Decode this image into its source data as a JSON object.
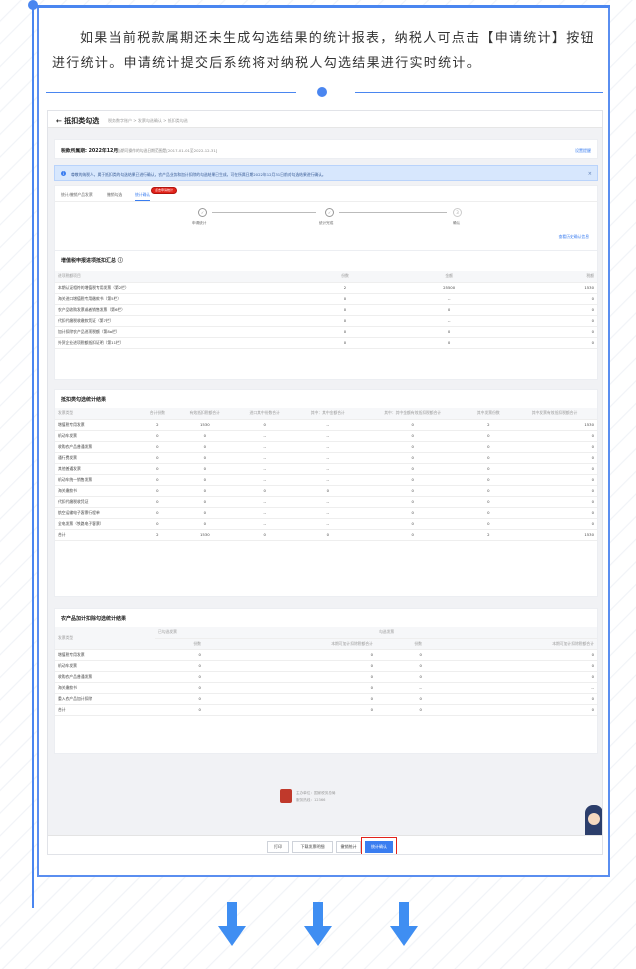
{
  "intro_text": "如果当前税款属期还未生成勾选结果的统计报表，纳税人可点击【申请统计】按钮进行统计。申请统计提交后系统将对纳税人勾选结果进行实时统计。",
  "app": {
    "back_label": "← 抵扣类勾选",
    "breadcrumb": "税务数字账户 > 发票勾选确认 > 抵扣类勾选"
  },
  "period": {
    "label": "税款所属期: 2022年12月",
    "range": "当期可操作的勾选日期范围是[2017-01-01至2022-12-31]",
    "link": "设置提醒"
  },
  "notice": {
    "text": "尊敬的纳税人，属于抵扣类的勾选结果已进行确认，农产品业务和加计扣除的勾选结果已生成，可在所属日期2022年12月31日前对勾选结果进行确认。",
    "close": "×"
  },
  "tabs": [
    "统计/撤销产品发票",
    "撤销勾选",
    "统计确认"
  ],
  "tab_badge": "点击申请统计",
  "steps": [
    {
      "label": "申请统计",
      "mark": "✓"
    },
    {
      "label": "统计完成",
      "mark": "✓"
    },
    {
      "label": "确认",
      "mark": "3"
    }
  ],
  "step_link": "查看历史确认信息",
  "summary": {
    "title": "增值税申报进项抵扣汇总 ⓘ",
    "headers": [
      "进项税额项目",
      "份数",
      "金额",
      "税额"
    ],
    "rows": [
      [
        "本期认证相符的增值税专用发票（第2栏）",
        "2",
        "25500",
        "1530"
      ],
      [
        "海关进口增值税专用缴款书（第5栏）",
        "0",
        "--",
        "0"
      ],
      [
        "农产品收购发票或者销售发票（第6栏）",
        "0",
        "0",
        "0"
      ],
      [
        "代扣代缴税收缴款凭证（第7栏）",
        "0",
        "--",
        "0"
      ],
      [
        "加计扣除农产品进项税额（第8a栏）",
        "0",
        "0",
        "0"
      ],
      [
        "外贸企业进项税额抵扣证明（第11栏）",
        "0",
        "0",
        "0"
      ]
    ]
  },
  "deduct": {
    "title": "抵扣类勾选统计结果",
    "headers": [
      "发票类型",
      "合计份数",
      "有效抵扣税额合计",
      "进口其中份数合计",
      "其中：其中金额合计",
      "其中：其中金额有效抵扣税额合计",
      "其中发票份数",
      "其中发票有效抵扣税额合计"
    ],
    "rows": [
      [
        "增值税专用发票",
        "2",
        "1530",
        "0",
        "--",
        "0",
        "2",
        "1530"
      ],
      [
        "机动车发票",
        "0",
        "0",
        "--",
        "--",
        "0",
        "0",
        "0"
      ],
      [
        "收购农产品普通发票",
        "0",
        "0",
        "--",
        "--",
        "0",
        "0",
        "0"
      ],
      [
        "通行费发票",
        "0",
        "0",
        "--",
        "--",
        "0",
        "0",
        "0"
      ],
      [
        "其他普通发票",
        "0",
        "0",
        "--",
        "--",
        "0",
        "0",
        "0"
      ],
      [
        "机动车统一销售发票",
        "0",
        "0",
        "--",
        "--",
        "0",
        "0",
        "0"
      ],
      [
        "海关缴款书",
        "0",
        "0",
        "0",
        "0",
        "0",
        "0",
        "0"
      ],
      [
        "代扣代缴税收凭证",
        "0",
        "0",
        "--",
        "--",
        "0",
        "0",
        "0"
      ],
      [
        "航空运输电子客票行程单",
        "0",
        "0",
        "--",
        "--",
        "0",
        "0",
        "0"
      ],
      [
        "全电发票（铁路电子客票）",
        "0",
        "0",
        "--",
        "--",
        "0",
        "0",
        "0"
      ],
      [
        "合计",
        "2",
        "1530",
        "0",
        "0",
        "0",
        "2",
        "1530"
      ]
    ]
  },
  "agri": {
    "title": "农产品加计扣除勾选统计结果",
    "group1": "已勾选发票",
    "group2": "勾选发票",
    "headers": [
      "发票类型",
      "份数",
      "本期可加计扣除税额合计",
      "份数",
      "本期可加计扣除税额合计"
    ],
    "rows": [
      [
        "增值税专用发票",
        "0",
        "0",
        "0",
        "0"
      ],
      [
        "机动车发票",
        "0",
        "0",
        "0",
        "0"
      ],
      [
        "收购农产品普通发票",
        "0",
        "0",
        "0",
        "0"
      ],
      [
        "海关缴款书",
        "0",
        "0",
        "--",
        "--"
      ],
      [
        "重入农产品加计扣除",
        "0",
        "0",
        "0",
        "0"
      ],
      [
        "合计",
        "0",
        "0",
        "0",
        "0"
      ]
    ]
  },
  "footer": {
    "line1": "主办单位：国家税务总局",
    "line2": "服务热线：12366"
  },
  "buttons": [
    "打印",
    "下载发票明细",
    "撤销统计",
    "统计确认"
  ],
  "colors": {
    "accent": "#3a7df0",
    "danger": "#e2231a"
  }
}
